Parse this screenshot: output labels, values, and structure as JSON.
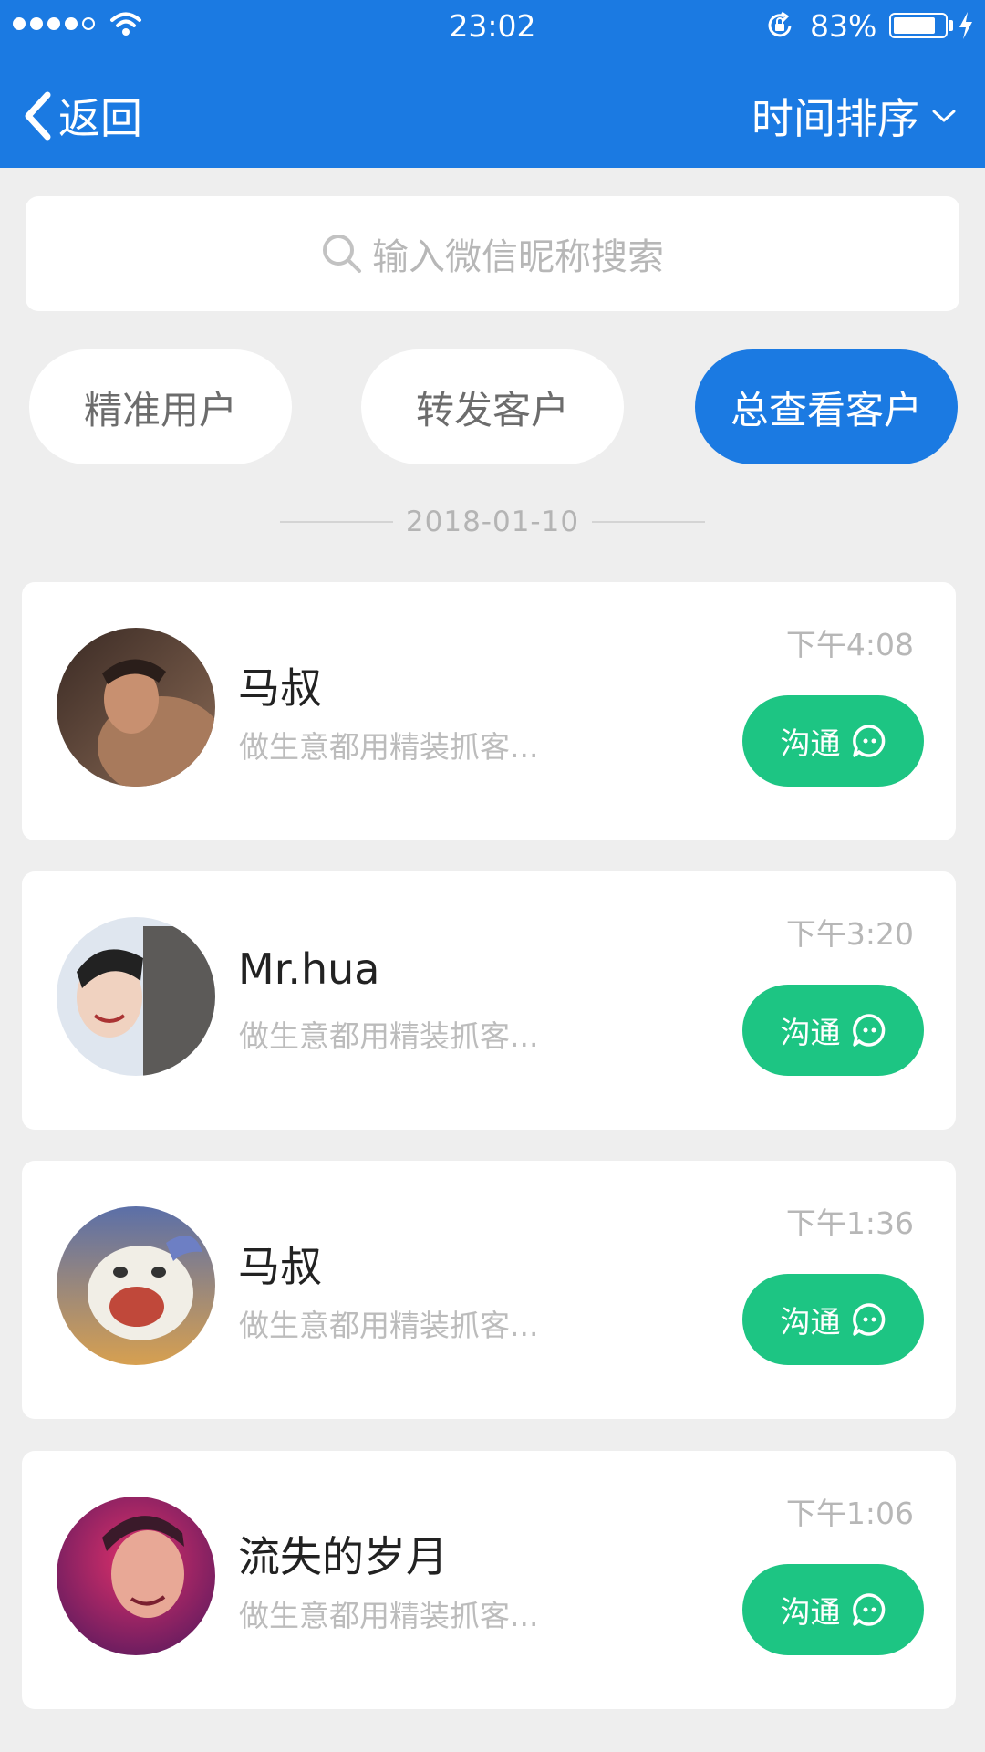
{
  "status_bar": {
    "time": "23:02",
    "battery": "83%",
    "battery_level": 0.83
  },
  "nav": {
    "back_label": "返回",
    "sort_label": "时间排序"
  },
  "search": {
    "placeholder": "输入微信昵称搜索"
  },
  "filters": [
    {
      "label": "精准用户",
      "active": false
    },
    {
      "label": "转发客户",
      "active": false
    },
    {
      "label": "总查看客户",
      "active": true
    }
  ],
  "date_separator": "2018-01-10",
  "contacts": [
    {
      "name": "马叔",
      "preview": "做生意都用精装抓客...",
      "time": "下午4:08",
      "action": "沟通"
    },
    {
      "name": "Mr.hua",
      "preview": "做生意都用精装抓客...",
      "time": "下午3:20",
      "action": "沟通"
    },
    {
      "name": "马叔",
      "preview": "做生意都用精装抓客...",
      "time": "下午1:36",
      "action": "沟通"
    },
    {
      "name": "流失的岁月",
      "preview": "做生意都用精装抓客...",
      "time": "下午1:06",
      "action": "沟通"
    }
  ],
  "colors": {
    "primary": "#1b7ae2",
    "chat_green": "#1dc583",
    "background": "#eeeeee"
  }
}
